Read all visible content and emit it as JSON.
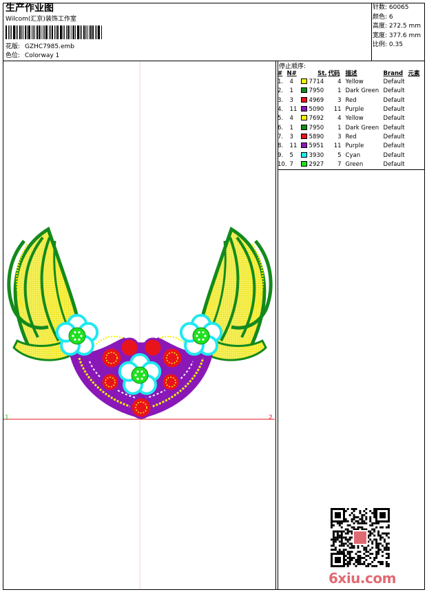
{
  "header": {
    "title": "生产作业图",
    "studio": "Wilcom(汇京)装饰工作室",
    "pattern_label": "花版:",
    "pattern_value": "GZHC7985.emb",
    "colorway_label": "色位:",
    "colorway_value": "Colorway 1"
  },
  "stats": {
    "stitches": "针数: 60065",
    "colors": "颜色: 6",
    "height": "高度: 272.5 mm",
    "width": "宽度: 377.6 mm",
    "scale": "比例: 0.35"
  },
  "stop_sequence": {
    "title": "停止顺序:",
    "headers": [
      "#",
      "N#",
      "St.",
      "代码",
      "描述",
      "Brand",
      "元素"
    ],
    "rows": [
      {
        "num": "1.",
        "n": "4",
        "color": "#f4f000",
        "st": "7714",
        "code": "4",
        "desc": "Yellow",
        "brand": "Default"
      },
      {
        "num": "2.",
        "n": "1",
        "color": "#138a1c",
        "st": "7950",
        "code": "1",
        "desc": "Dark Green",
        "brand": "Default"
      },
      {
        "num": "3.",
        "n": "3",
        "color": "#e8141c",
        "st": "4969",
        "code": "3",
        "desc": "Red",
        "brand": "Default"
      },
      {
        "num": "4.",
        "n": "11",
        "color": "#8a18b8",
        "st": "5090",
        "code": "11",
        "desc": "Purple",
        "brand": "Default"
      },
      {
        "num": "5.",
        "n": "4",
        "color": "#f4f000",
        "st": "7692",
        "code": "4",
        "desc": "Yellow",
        "brand": "Default"
      },
      {
        "num": "6.",
        "n": "1",
        "color": "#138a1c",
        "st": "7950",
        "code": "1",
        "desc": "Dark Green",
        "brand": "Default"
      },
      {
        "num": "7.",
        "n": "3",
        "color": "#e8141c",
        "st": "5890",
        "code": "3",
        "desc": "Red",
        "brand": "Default"
      },
      {
        "num": "8.",
        "n": "11",
        "color": "#8a18b8",
        "st": "5951",
        "code": "11",
        "desc": "Purple",
        "brand": "Default"
      },
      {
        "num": "9.",
        "n": "5",
        "color": "#20e8f0",
        "st": "3930",
        "code": "5",
        "desc": "Cyan",
        "brand": "Default"
      },
      {
        "num": "10.",
        "n": "7",
        "color": "#20e020",
        "st": "2927",
        "code": "7",
        "desc": "Green",
        "brand": "Default"
      }
    ]
  },
  "markers": {
    "start": "1",
    "end": "2"
  },
  "watermark": {
    "logo": "6xiu.com"
  }
}
